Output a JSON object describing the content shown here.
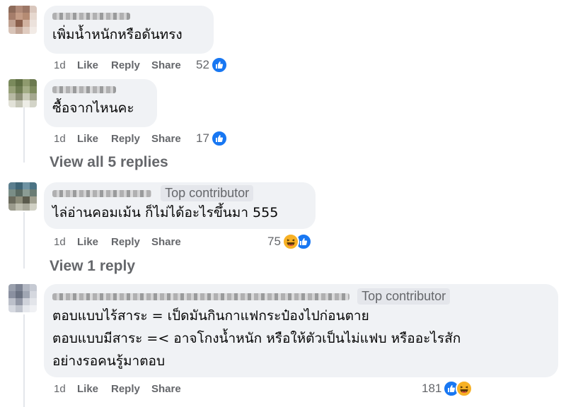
{
  "colors": {
    "bubble": "#f0f2f5",
    "meta": "#65676b",
    "like": "#1877f2",
    "haha": "#f7b125"
  },
  "comments": [
    {
      "text_lines": [
        "เพิ่มน้ำหนักหรือดันทรง"
      ],
      "time": "1d",
      "like": "Like",
      "reply": "Reply",
      "share": "Share",
      "count": "52",
      "reactions": [
        "like-icon"
      ]
    },
    {
      "text_lines": [
        "ซื้อจากไหนคะ"
      ],
      "time": "1d",
      "like": "Like",
      "reply": "Reply",
      "share": "Share",
      "count": "17",
      "reactions": [
        "like-icon"
      ],
      "view_replies": "View all 5 replies"
    },
    {
      "badge": "Top contributor",
      "text_lines": [
        "ไล่อ่านคอมเม้น ก็ไม่ได้อะไรขึ้นมา 555"
      ],
      "time": "1d",
      "like": "Like",
      "reply": "Reply",
      "share": "Share",
      "count": "75",
      "reactions": [
        "haha-icon",
        "like-icon"
      ],
      "view_replies": "View 1 reply"
    },
    {
      "badge": "Top contributor",
      "text_lines": [
        "ตอบแบบไร้สาระ = เป็ดมันกินกาแฟกระป๋องไปก่อนตาย",
        "ตอบแบบมีสาระ =< อาจโกงน้ำหนัก หรือให้ตัวเป็นไม่แฟบ หรืออะไรสัก",
        "อย่างรอคนรู้มาตอบ"
      ],
      "time": "1d",
      "like": "Like",
      "reply": "Reply",
      "share": "Share",
      "count": "181",
      "reactions": [
        "like-icon",
        "haha-icon"
      ]
    }
  ]
}
